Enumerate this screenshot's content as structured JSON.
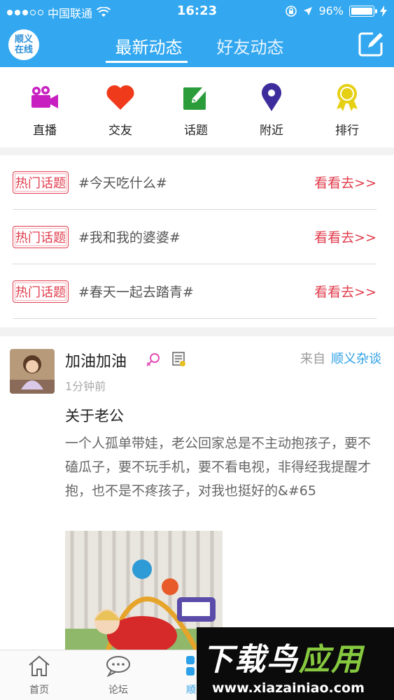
{
  "status_bar": {
    "carrier": "中国联通",
    "time": "16:23",
    "battery": "96%"
  },
  "header": {
    "logo_line1": "顺义",
    "logo_line2": "在线",
    "tabs": [
      {
        "label": "最新动态",
        "active": true
      },
      {
        "label": "好友动态",
        "active": false
      }
    ]
  },
  "categories": [
    {
      "label": "直播",
      "icon": "video-camera-icon",
      "color": "#c81fc0"
    },
    {
      "label": "交友",
      "icon": "heart-icon",
      "color": "#f03a1c"
    },
    {
      "label": "话题",
      "icon": "pencil-edit-icon",
      "color": "#2a9c3a"
    },
    {
      "label": "附近",
      "icon": "location-pin-icon",
      "color": "#3d2c9c"
    },
    {
      "label": "排行",
      "icon": "award-medal-icon",
      "color": "#e6d015"
    }
  ],
  "hot_topics": {
    "badge": "热门话题",
    "go_label": "看看去>>",
    "items": [
      {
        "title": "#今天吃什么#"
      },
      {
        "title": "#我和我的婆婆#"
      },
      {
        "title": "#春天一起去踏青#"
      }
    ]
  },
  "post": {
    "username": "加油加油",
    "time": "1分钟前",
    "from_label": "来自",
    "board": "顺义杂谈",
    "title": "关于老公",
    "body": "一个人孤单带娃，老公回家总是不主动抱孩子，要不磕瓜子，要不玩手机，要不看电视，非得经我提醒才抱，也不是不疼孩子，对我也挺好的&#65"
  },
  "bottom_nav": [
    {
      "label": "首页",
      "icon": "home-icon"
    },
    {
      "label": "论坛",
      "icon": "chat-bubble-icon"
    },
    {
      "label": "顺义",
      "icon": "grid-icon"
    }
  ],
  "watermark": {
    "text_main": "下载鸟",
    "text_accent": "应用",
    "url": "www.xiazainiao.com"
  },
  "colors": {
    "header_blue": "#33a8f0",
    "hot_red": "#e03c4c",
    "link_blue": "#2ca0e8"
  }
}
